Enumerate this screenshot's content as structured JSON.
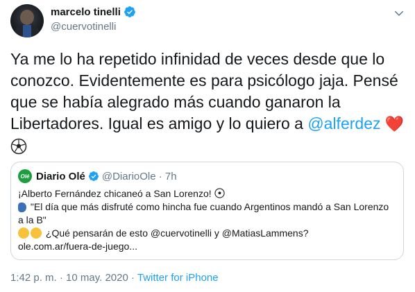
{
  "author": {
    "display_name": "marcelo tinelli",
    "handle": "@cuervotinelli"
  },
  "tweet": {
    "text_part1": "Ya me lo ha repetido infinidad de veces desde que lo conozco. Evidentemente es para psicólogo jaja. Pensé que se había alegrado más cuando ganaron la Libertadores. Igual es amigo y lo quiero a ",
    "mention": "@alferdez",
    "heart": "❤️"
  },
  "quote": {
    "logo_text": "Olé",
    "display_name": "Diario Olé",
    "handle_time": "@DiarioOle · 7h",
    "line1": "¡Alberto Fernández chicaneó a San Lorenzo!",
    "line2": "\"El día que más disfruté como hincha fue cuando Argentinos mandó a San Lorenzo a la B\"",
    "line3": "¿Qué pensarán de esto @cuervotinelli y @MatiasLammens?",
    "line4": "ole.com.ar/fuera-de-juego..."
  },
  "meta": {
    "timestamp": "1:42 p. m. · 10 may. 2020 · ",
    "source": "Twitter for iPhone"
  },
  "icons": {
    "verified": "verified-badge-icon",
    "menu": "chevron-down-icon",
    "ball": "soccer-ball-icon"
  },
  "colors": {
    "link": "#1da1f2",
    "secondary_text": "#657786",
    "border": "#ccd6dd",
    "heart": "#e0245e"
  }
}
